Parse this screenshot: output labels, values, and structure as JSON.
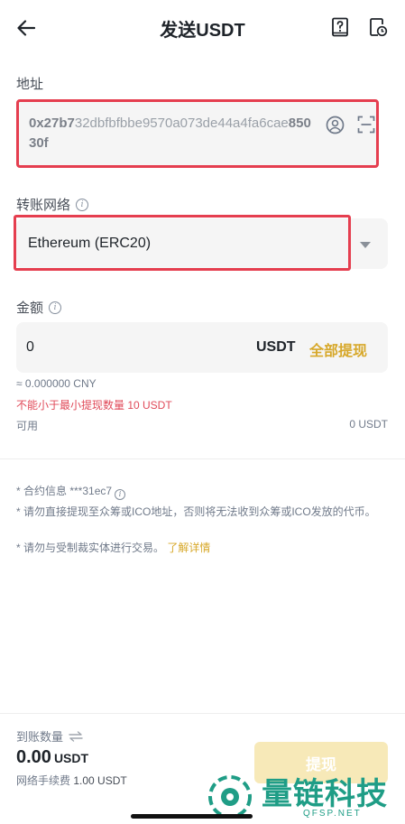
{
  "header": {
    "title": "发送USDT",
    "back_icon": "arrow-left-icon",
    "right_icons": [
      "help-book-icon",
      "history-icon"
    ]
  },
  "address": {
    "label": "地址",
    "value_head": "0x27b7",
    "value_mid": "32dbfbfbbe9570a073de44a4fa6cae",
    "value_tail": "85030f",
    "icons": [
      "contact-icon",
      "scan-icon"
    ]
  },
  "network": {
    "label": "转账网络",
    "selected": "Ethereum (ERC20)"
  },
  "amount": {
    "label": "金额",
    "value": "0",
    "unit": "USDT",
    "max_label": "全部提现",
    "fiat_estimate": "≈ 0.000000 CNY",
    "error": "不能小于最小提现数量 10 USDT",
    "available_label": "可用",
    "available_value": "0 USDT"
  },
  "notes": {
    "contract": "* 合约信息 ***31ec7",
    "warning_ico": "* 请勿直接提现至众筹或ICO地址，否则将无法收到众筹或ICO发放的代币。",
    "sanction": "* 请勿与受制裁实体进行交易。",
    "learn_more": "了解详情"
  },
  "summary": {
    "received_label": "到账数量",
    "received_value": "0.00",
    "received_unit": "USDT",
    "fee_label": "网络手续费",
    "fee_value": "1.00 USDT",
    "submit_label": "提现"
  },
  "watermark": {
    "text": "量链科技",
    "sub": "QFSP.NET"
  },
  "colors": {
    "accent": "#d7a82a",
    "error": "#e04a59",
    "highlight_border": "#e53e4f"
  }
}
